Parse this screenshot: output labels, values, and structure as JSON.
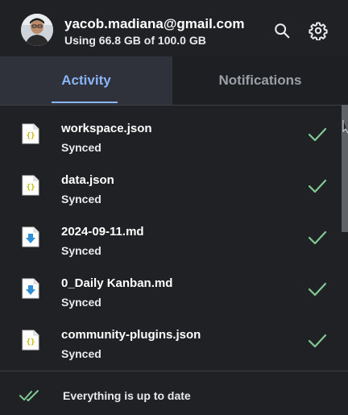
{
  "header": {
    "email": "yacob.madiana@gmail.com",
    "usage": "Using 66.8 GB of 100.0 GB",
    "avatar_icon": "user-avatar",
    "search_icon": "search-icon",
    "settings_icon": "gear-icon"
  },
  "tabs": [
    {
      "label": "Activity",
      "active": true
    },
    {
      "label": "Notifications",
      "active": false
    }
  ],
  "files": [
    {
      "name": "workspace.json",
      "status": "Synced",
      "icon": "json-file-icon"
    },
    {
      "name": "data.json",
      "status": "Synced",
      "icon": "json-file-icon"
    },
    {
      "name": "2024-09-11.md",
      "status": "Synced",
      "icon": "markdown-file-icon"
    },
    {
      "name": "0_Daily Kanban.md",
      "status": "Synced",
      "icon": "markdown-file-icon"
    },
    {
      "name": "community-plugins.json",
      "status": "Synced",
      "icon": "json-file-icon"
    }
  ],
  "footer": {
    "status_text": "Everything is up to date",
    "icon": "double-check-icon"
  },
  "colors": {
    "background": "#202124",
    "accent": "#8ab4f8",
    "check": "#81c995",
    "md_icon": "#2f8fd6",
    "json_icon": "#c5b800"
  }
}
